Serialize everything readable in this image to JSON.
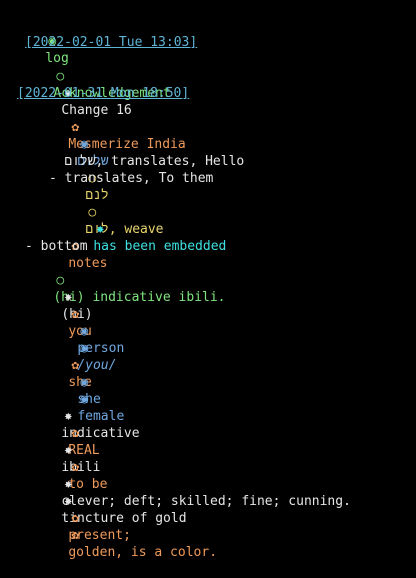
{
  "log": {
    "bullet": "◉",
    "label": "log"
  },
  "entries": {
    "ts1": "[2022-02-01 Tue 13:03]",
    "ack": {
      "bullet": "○",
      "label": "Acknowledgement"
    },
    "change": {
      "bullet": "✸",
      "label": "Change 16"
    },
    "ts2": "[2022-01-31 Mon 18:50]",
    "mesmerize": {
      "bullet": "✿",
      "label": "Mesmerize India"
    },
    "shalom1": {
      "bullet": "◉",
      "label": "שלום"
    },
    "shalom_line": {
      "heb": "שלום",
      "rest": ", translates, Hello"
    },
    "lanam": {
      "bullet": "○",
      "label": "לנם"
    },
    "translates_them": "- translates, To them",
    "weave": {
      "bullet": "○",
      "heb": "לום",
      "rest": ", weave"
    },
    "embedded": {
      "bullet": "✸",
      "label": "has been embedded"
    },
    "notes": {
      "bullet": "✿",
      "label": "notes"
    },
    "bottom": "- bottom",
    "indicative_ibili": {
      "bullet": "○",
      "label": "(hi) indicative ibili."
    },
    "hi": {
      "bullet": "✸",
      "label": "(hi)"
    },
    "you": {
      "bullet": "✿",
      "label": "you"
    },
    "person": {
      "bullet": "◉",
      "label": "person"
    },
    "you_italic": {
      "bullet": "◉",
      "label": "/you/"
    },
    "she": {
      "bullet": "✿",
      "label": "she"
    },
    "she2": {
      "bullet": "◉",
      "label": "she"
    },
    "female": {
      "bullet": "◉",
      "label": "female"
    },
    "indicative": {
      "bullet": "✸",
      "label": "indicative"
    },
    "real": {
      "bullet": "✿",
      "label": "REAL"
    },
    "ibili": {
      "bullet": "✸",
      "label": "ibili"
    },
    "to_be": {
      "bullet": "✿",
      "label": "to be"
    },
    "clever": {
      "bullet": "✸",
      "label": "clever; deft; skilled; fine; cunning."
    },
    "tincture": {
      "bullet": "✸",
      "label": "tincture of gold"
    },
    "present": {
      "bullet": "✿",
      "label": "present;"
    },
    "golden": {
      "bullet": "✿",
      "label": "golden, is a color."
    }
  }
}
